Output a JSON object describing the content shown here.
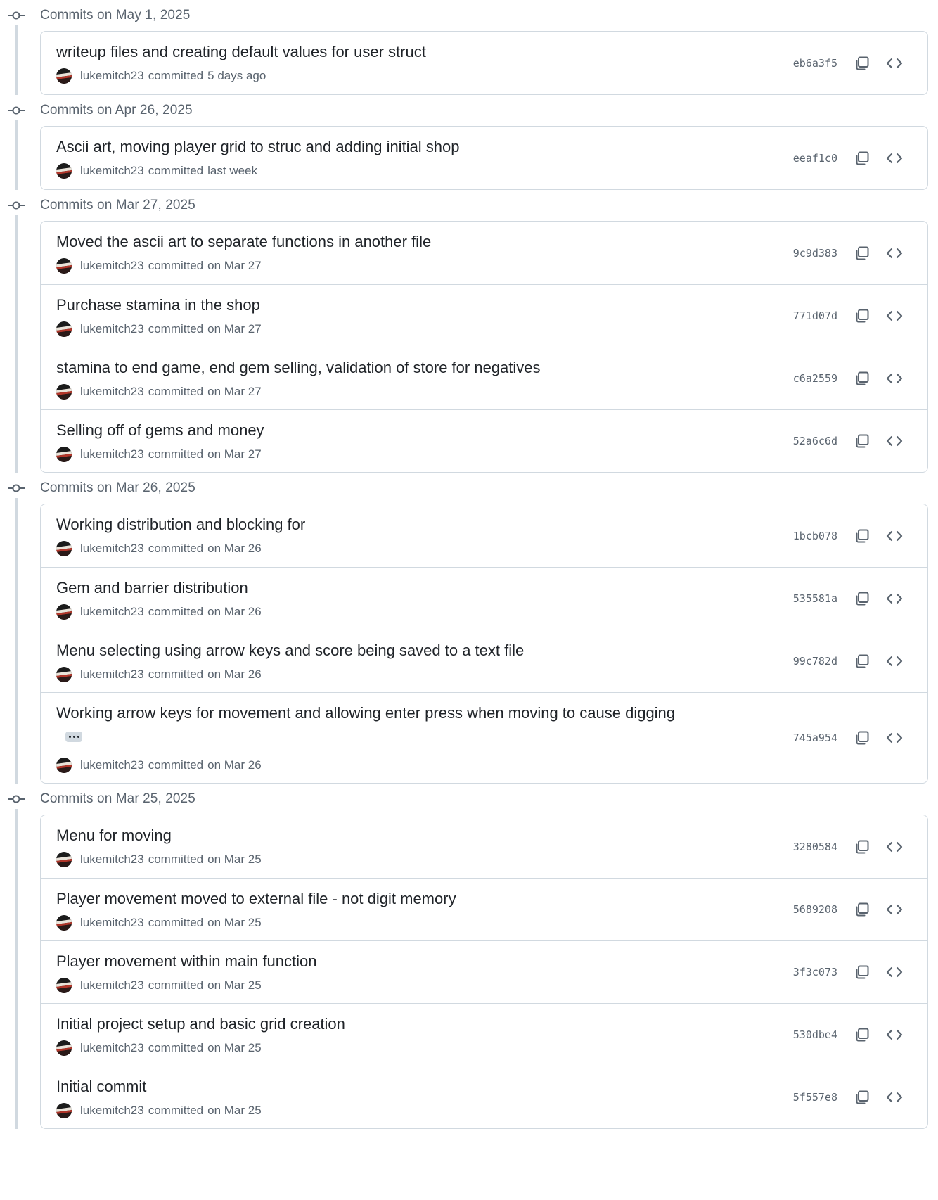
{
  "colors": {
    "border": "#d1d9e0",
    "muted": "#59636e",
    "text": "#1f2328",
    "icon": "#59636e"
  },
  "icons": {
    "group_node": "git-commit-icon",
    "copy": "copy-icon",
    "browse": "code-icon",
    "ellipsis": "kebab-horizontal-icon"
  },
  "groups": [
    {
      "date": "Commits on May 1, 2025",
      "commits": [
        {
          "title": "writeup files and creating default values for user struct",
          "author": "lukemitch23",
          "verb": "committed",
          "when": "5 days ago",
          "sha": "eb6a3f5"
        }
      ]
    },
    {
      "date": "Commits on Apr 26, 2025",
      "commits": [
        {
          "title": "Ascii art, moving player grid to struc and adding initial shop",
          "author": "lukemitch23",
          "verb": "committed",
          "when": "last week",
          "sha": "eeaf1c0"
        }
      ]
    },
    {
      "date": "Commits on Mar 27, 2025",
      "commits": [
        {
          "title": "Moved the ascii art to separate functions in another file",
          "author": "lukemitch23",
          "verb": "committed",
          "when": "on Mar 27",
          "sha": "9c9d383"
        },
        {
          "title": "Purchase stamina in the shop",
          "author": "lukemitch23",
          "verb": "committed",
          "when": "on Mar 27",
          "sha": "771d07d"
        },
        {
          "title": "stamina to end game, end gem selling, validation of store for negatives",
          "author": "lukemitch23",
          "verb": "committed",
          "when": "on Mar 27",
          "sha": "c6a2559"
        },
        {
          "title": "Selling off of gems and money",
          "author": "lukemitch23",
          "verb": "committed",
          "when": "on Mar 27",
          "sha": "52a6c6d"
        }
      ]
    },
    {
      "date": "Commits on Mar 26, 2025",
      "commits": [
        {
          "title": "Working distribution and blocking for",
          "author": "lukemitch23",
          "verb": "committed",
          "when": "on Mar 26",
          "sha": "1bcb078"
        },
        {
          "title": "Gem and barrier distribution",
          "author": "lukemitch23",
          "verb": "committed",
          "when": "on Mar 26",
          "sha": "535581a"
        },
        {
          "title": "Menu selecting using arrow keys and score being saved to a text file",
          "author": "lukemitch23",
          "verb": "committed",
          "when": "on Mar 26",
          "sha": "99c782d"
        },
        {
          "title": "Working arrow keys for movement and allowing enter press when moving to cause digging",
          "author": "lukemitch23",
          "verb": "committed",
          "when": "on Mar 26",
          "sha": "745a954",
          "has_more": true
        }
      ]
    },
    {
      "date": "Commits on Mar 25, 2025",
      "commits": [
        {
          "title": "Menu for moving",
          "author": "lukemitch23",
          "verb": "committed",
          "when": "on Mar 25",
          "sha": "3280584"
        },
        {
          "title": "Player movement moved to external file - not digit memory",
          "author": "lukemitch23",
          "verb": "committed",
          "when": "on Mar 25",
          "sha": "5689208"
        },
        {
          "title": "Player movement within main function",
          "author": "lukemitch23",
          "verb": "committed",
          "when": "on Mar 25",
          "sha": "3f3c073"
        },
        {
          "title": "Initial project setup and basic grid creation",
          "author": "lukemitch23",
          "verb": "committed",
          "when": "on Mar 25",
          "sha": "530dbe4"
        },
        {
          "title": "Initial commit",
          "author": "lukemitch23",
          "verb": "committed",
          "when": "on Mar 25",
          "sha": "5f557e8"
        }
      ]
    }
  ]
}
